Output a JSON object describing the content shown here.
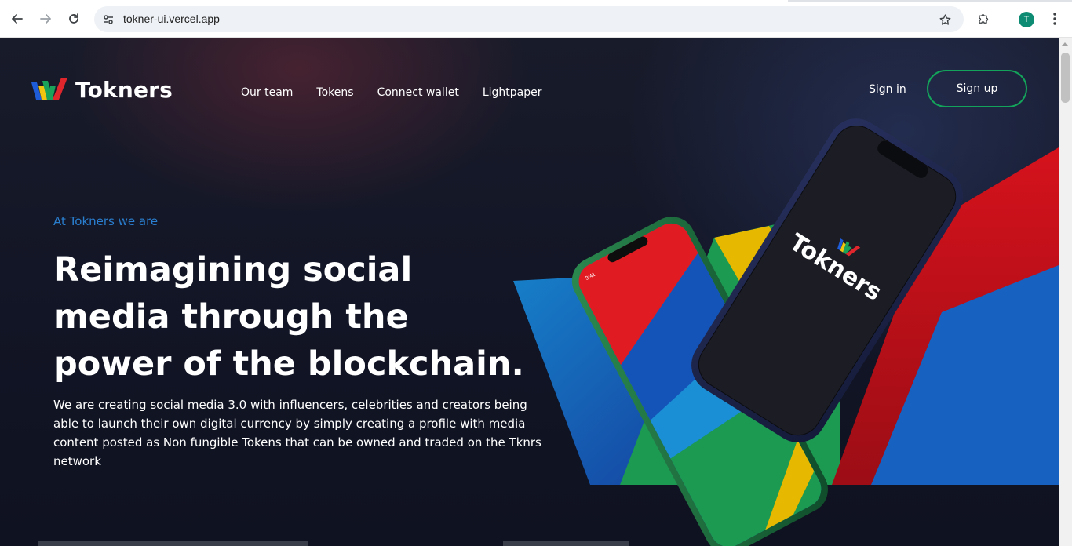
{
  "browser": {
    "url": "tokner-ui.vercel.app",
    "profile_initial": "T",
    "profile_color": "#0e8c73",
    "icons": [
      "back-arrow-icon",
      "forward-arrow-icon",
      "reload-icon",
      "site-settings-icon",
      "bookmark-star-icon",
      "extensions-icon",
      "more-menu-icon"
    ]
  },
  "site": {
    "brand": "Tokners",
    "nav": [
      {
        "label": "Our team"
      },
      {
        "label": "Tokens"
      },
      {
        "label": "Connect wallet"
      },
      {
        "label": "Lightpaper"
      }
    ],
    "sign_in": "Sign in",
    "sign_up": "Sign up",
    "accent_green": "#14a35a",
    "accent_blue": "#2a7fd0"
  },
  "hero": {
    "eyebrow": "At Tokners we are",
    "headline_line1": "Reimagining social",
    "headline_line2": "media through the",
    "headline_line3": "power of the blockchain.",
    "lead": "We are creating social media 3.0 with influencers, celebrities and creators being able to launch their own digital currency by simply creating a profile with media content posted as Non fungible Tokens that can be owned and traded on the Tknrs network",
    "phone_wordmark": "Tokners",
    "phone_time": "9:41"
  }
}
